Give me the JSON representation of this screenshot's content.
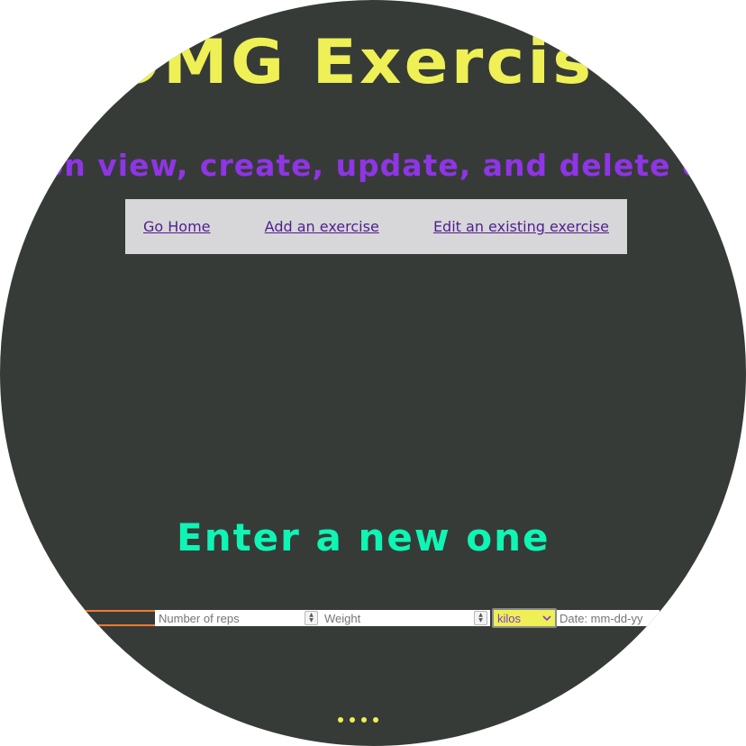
{
  "app": {
    "title": "OMG Exercise",
    "subtitle": "on view, create, update, and delete e"
  },
  "nav": {
    "items": [
      {
        "label": "Go Home"
      },
      {
        "label": "Add an exercise"
      },
      {
        "label": "Edit an existing exercise"
      }
    ]
  },
  "form": {
    "heading": "Enter a new one",
    "reps_placeholder": "Number of reps",
    "weight_placeholder": "Weight",
    "unit_selected": "kilos",
    "date_placeholder": "Date: mm-dd-yy"
  },
  "pager": {
    "dot_count": 4
  },
  "colors": {
    "background": "#373b38",
    "title": "#eef055",
    "subtitle": "#8f34e6",
    "nav_bg": "#d7d6d9",
    "nav_link": "#4f1f8f",
    "heading": "#0ef5b4",
    "accent_orange": "#f07a2f"
  }
}
